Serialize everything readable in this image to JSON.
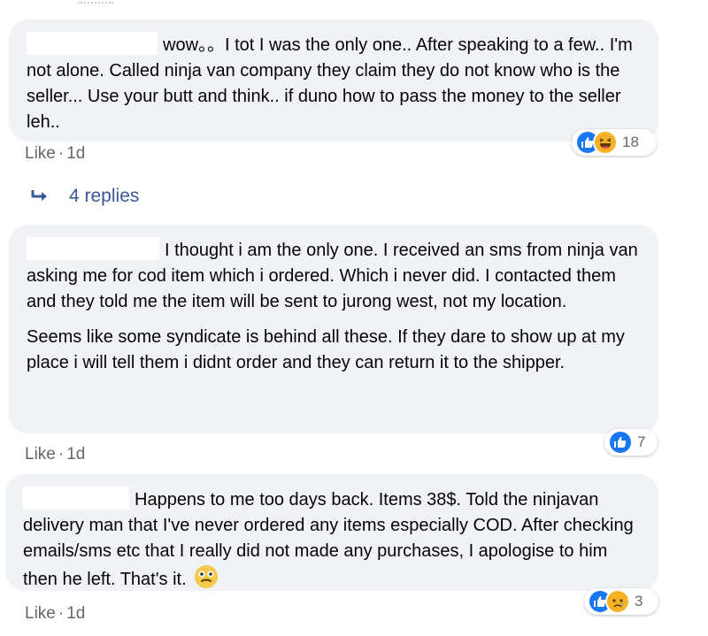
{
  "comments": [
    {
      "paragraphs": [
        "wow。。I tot I was the only one.. After speaking to a few.. I'm not alone. Called ninja van company they claim they do not know who is the seller... Use your butt and think.. if duno how to pass the money to the seller leh.."
      ],
      "like_label": "Like",
      "separator": "·",
      "time": "1d",
      "reaction_count": "18",
      "reactions": [
        "like-icon",
        "haha-icon"
      ]
    },
    {
      "paragraphs": [
        "I thought i am the only one. I received an sms from ninja van asking me for cod item which i ordered. Which i never did. I contacted them and they told me the item will be sent to jurong west, not my location.",
        "Seems like some syndicate is behind all these. If they dare to show up at my place i will tell them i didnt order and they can return it to the shipper."
      ],
      "like_label": "Like",
      "separator": "·",
      "time": "1d",
      "reaction_count": "7",
      "reactions": [
        "like-icon"
      ]
    },
    {
      "paragraphs": [
        "Happens to me too days back. Items 38$. Told the ninjavan delivery man that I've never ordered any items especially COD. After checking emails/sms etc that I really did not made any purchases, I apologise to him then he left. That's it."
      ],
      "like_label": "Like",
      "separator": "·",
      "time": "1d",
      "reaction_count": "3",
      "reactions": [
        "like-icon",
        "sad-icon"
      ],
      "trailing_emoji": "grimace-emoji"
    }
  ],
  "replies": {
    "label": "4 replies",
    "icon": "reply-arrow-icon"
  },
  "colors": {
    "bubble": "#f0f2f5",
    "meta_text": "#65676b",
    "link": "#385898",
    "like_blue": "#1877f2",
    "emoji_yellow": "#f7b125"
  }
}
